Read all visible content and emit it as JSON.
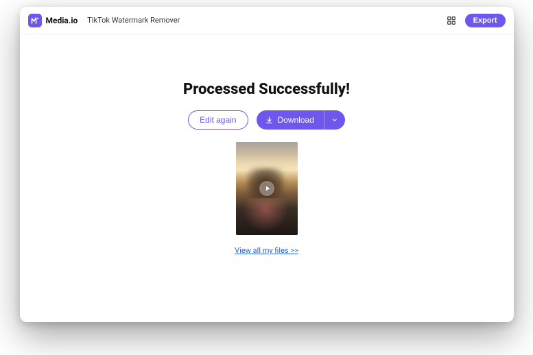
{
  "header": {
    "brand": "Media.io",
    "subtitle": "TikTok Watermark Remover",
    "export_label": "Export"
  },
  "main": {
    "title": "Processed Successfully!",
    "edit_again_label": "Edit again",
    "download_label": "Download",
    "view_files_label": "View all my files >>"
  },
  "icons": {
    "logo": "media-logo",
    "grid": "apps-grid-icon",
    "download": "download-icon",
    "chevron": "chevron-down-icon",
    "play": "play-icon"
  }
}
